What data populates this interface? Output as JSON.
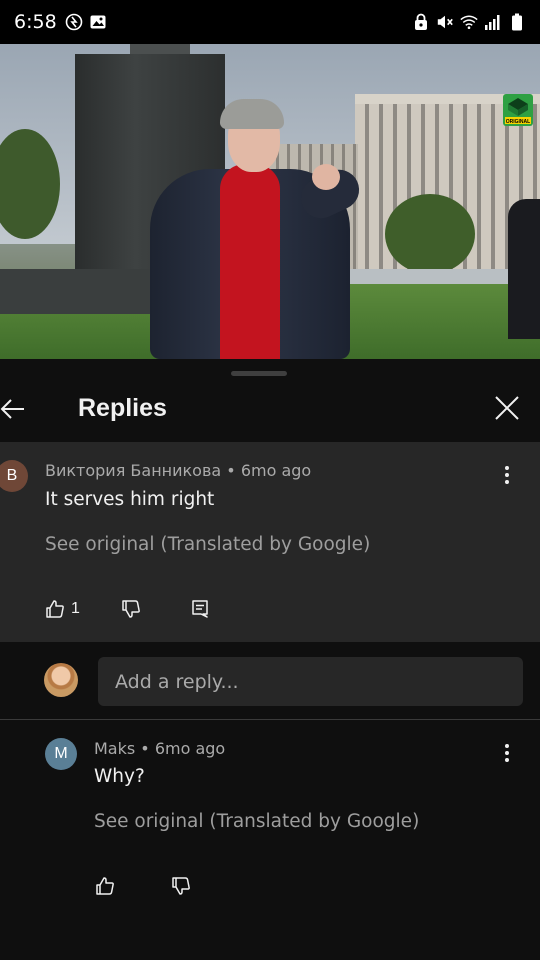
{
  "status_bar": {
    "time": "6:58",
    "left_icons": [
      "data-saver-icon",
      "gallery-icon"
    ],
    "right_icons": [
      "lock-vpn-icon",
      "mute-icon",
      "wifi-icon",
      "signal-icon",
      "battery-icon"
    ]
  },
  "video": {
    "badge_text": "ORIGINAL",
    "badge_color": "#2ea043"
  },
  "sheet": {
    "title": "Replies",
    "back_icon": "arrow-left-icon",
    "close_icon": "close-icon"
  },
  "parent_comment": {
    "avatar_letter": "B",
    "author": "Виктория Банникова",
    "age": "6mo ago",
    "text": "It serves him right",
    "see_original": "See original (Translated by Google)",
    "like_count": "1"
  },
  "reply_bar": {
    "placeholder": "Add a reply..."
  },
  "replies": [
    {
      "avatar_letter": "M",
      "author": "Maks",
      "age": "6mo ago",
      "text": "Why?",
      "see_original": "See original (Translated by Google)"
    }
  ],
  "colors": {
    "background": "#0f0f0f",
    "highlight": "#272727",
    "text": "#f1f1f1",
    "secondary_text": "#aaaaaa"
  }
}
